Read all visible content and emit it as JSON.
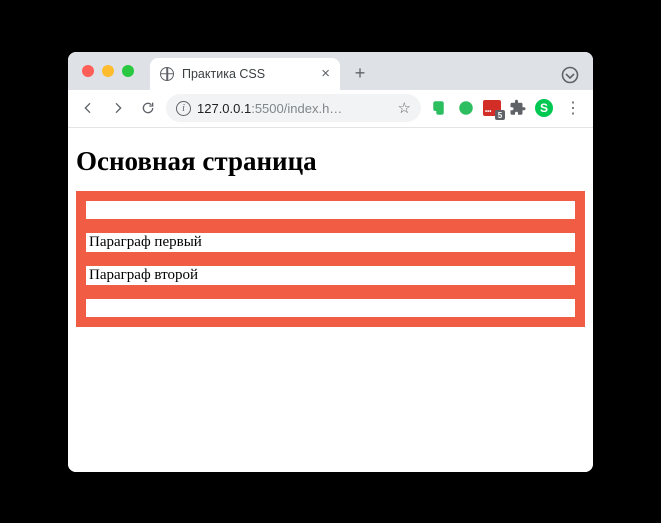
{
  "window": {
    "tab_title": "Практика CSS"
  },
  "toolbar": {
    "url_host": "127.0.0.1",
    "url_port": ":5500",
    "url_path": "/index.h…",
    "extensions": {
      "lastpass_badge": "5",
      "profile_letter": "S"
    }
  },
  "page": {
    "heading": "Основная страница",
    "paragraphs": [
      "",
      "Параграф первый",
      "Параграф второй",
      ""
    ]
  }
}
